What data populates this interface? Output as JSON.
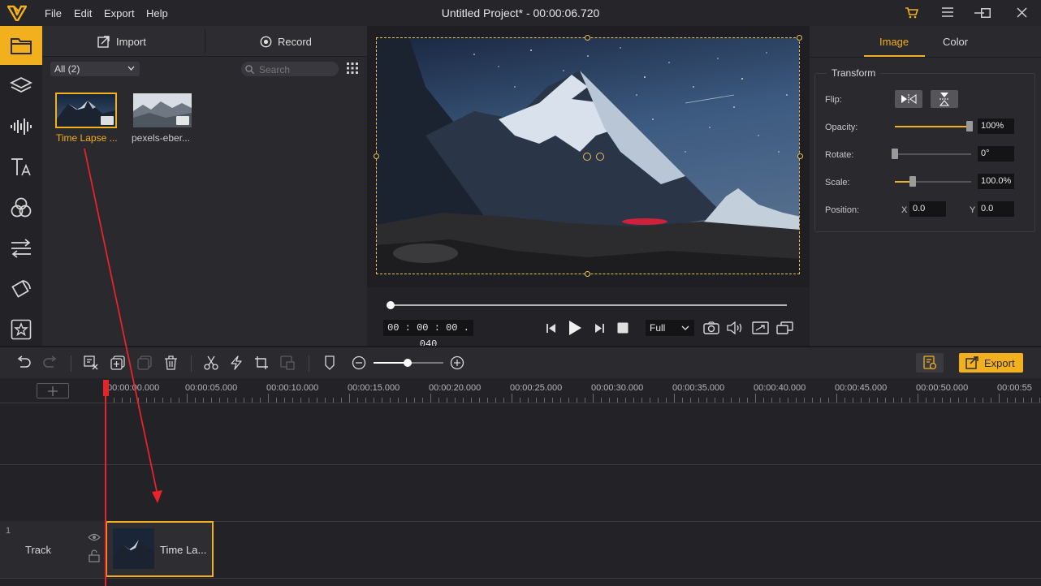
{
  "menu": {
    "file": "File",
    "edit": "Edit",
    "export": "Export",
    "help": "Help"
  },
  "title": "Untitled Project* - 00:00:06.720",
  "sidebar": [
    "media-icon",
    "layers-icon",
    "audio-icon",
    "text-icon",
    "filters-icon",
    "transitions-icon",
    "overlays-icon",
    "elements-icon"
  ],
  "media": {
    "import_label": "Import",
    "record_label": "Record",
    "filter_value": "All (2)",
    "search_placeholder": "Search",
    "items": [
      {
        "label": "Time Lapse ...",
        "selected": true
      },
      {
        "label": "pexels-eber...",
        "selected": false
      }
    ]
  },
  "player": {
    "timecode": "00 : 00 : 00 . 040",
    "quality": "Full",
    "progress": 0.0
  },
  "properties": {
    "tab_image": "Image",
    "tab_color": "Color",
    "group_title": "Transform",
    "flip_label": "Flip:",
    "opacity_label": "Opacity:",
    "opacity_value": "100%",
    "rotate_label": "Rotate:",
    "rotate_value": "0°",
    "scale_label": "Scale:",
    "scale_value": "100.0%",
    "position_label": "Position:",
    "pos_x_label": "X",
    "pos_x_value": "0.0",
    "pos_y_label": "Y",
    "pos_y_value": "0.0"
  },
  "toolbar": {
    "export_label": "Export"
  },
  "timeline": {
    "ticks": [
      "00:00:00.000",
      "00:00:05.000",
      "00:00:10.000",
      "00:00:15.000",
      "00:00:20.000",
      "00:00:25.000",
      "00:00:30.000",
      "00:00:35.000",
      "00:00:40.000",
      "00:00:45.000",
      "00:00:50.000",
      "00:00:55"
    ],
    "track_number": "1",
    "track_label": "Track",
    "clip_label": "Time La..."
  },
  "colors": {
    "accent": "#f2b01e",
    "annotation_arrow": "#e8232a"
  }
}
